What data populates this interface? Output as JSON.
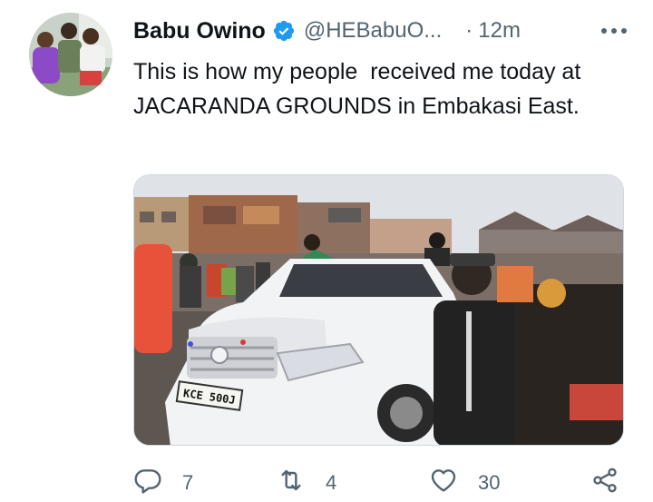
{
  "tweet": {
    "author_name": "Babu Owino",
    "handle": "@HEBabuO...",
    "separator": "·",
    "time": "12m",
    "text": "This is how my people  received me today at JACARANDA GROUNDS in Embakasi East.",
    "media": {
      "plate": "KCE 500J"
    },
    "actions": {
      "replies": "7",
      "retweets": "4",
      "likes": "30"
    }
  },
  "icons": {
    "verified": "verified-badge-icon",
    "more": "more-horizontal-icon",
    "reply": "reply-icon",
    "retweet": "retweet-icon",
    "like": "heart-icon",
    "share": "share-icon"
  },
  "colors": {
    "verified": "#1d9bf0",
    "secondary_text": "#536471",
    "primary_text": "#0f1419"
  }
}
